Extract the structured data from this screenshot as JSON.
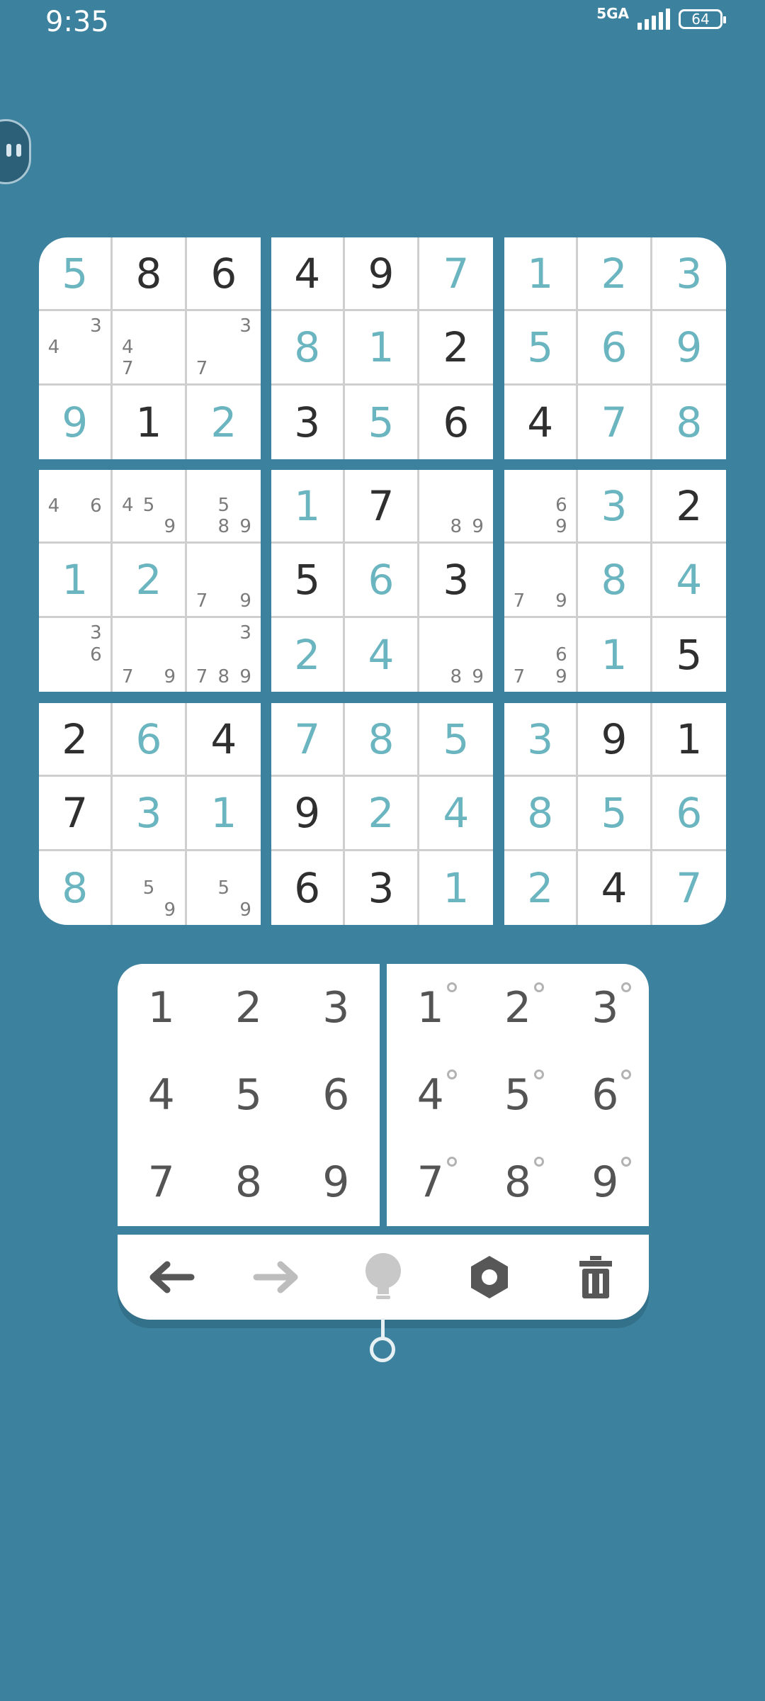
{
  "status_bar": {
    "time": "9:35",
    "network": "5GA",
    "battery": "64"
  },
  "colors": {
    "background": "#3c819d",
    "user_digit": "#6ab5bf",
    "given_digit": "#2f2f2f",
    "note": "#7b7b7b"
  },
  "board": {
    "cells": [
      [
        {
          "v": "5",
          "t": "user"
        },
        {
          "v": "8",
          "t": "given"
        },
        {
          "v": "6",
          "t": "given"
        },
        {
          "v": "4",
          "t": "given"
        },
        {
          "v": "9",
          "t": "given"
        },
        {
          "v": "7",
          "t": "user"
        },
        {
          "v": "1",
          "t": "user"
        },
        {
          "v": "2",
          "t": "user"
        },
        {
          "v": "3",
          "t": "user"
        }
      ],
      [
        {
          "n": [
            "3",
            "4"
          ]
        },
        {
          "n": [
            "4",
            "7"
          ]
        },
        {
          "n": [
            "3",
            "7"
          ]
        },
        {
          "v": "8",
          "t": "user"
        },
        {
          "v": "1",
          "t": "user"
        },
        {
          "v": "2",
          "t": "given"
        },
        {
          "v": "5",
          "t": "user"
        },
        {
          "v": "6",
          "t": "user"
        },
        {
          "v": "9",
          "t": "user"
        }
      ],
      [
        {
          "v": "9",
          "t": "user"
        },
        {
          "v": "1",
          "t": "given"
        },
        {
          "v": "2",
          "t": "user"
        },
        {
          "v": "3",
          "t": "given"
        },
        {
          "v": "5",
          "t": "user"
        },
        {
          "v": "6",
          "t": "given"
        },
        {
          "v": "4",
          "t": "given"
        },
        {
          "v": "7",
          "t": "user"
        },
        {
          "v": "8",
          "t": "user"
        }
      ],
      [
        {
          "n": [
            "4",
            "6"
          ]
        },
        {
          "n": [
            "4",
            "5",
            "9"
          ]
        },
        {
          "n": [
            "5",
            "8",
            "9"
          ]
        },
        {
          "v": "1",
          "t": "user"
        },
        {
          "v": "7",
          "t": "given"
        },
        {
          "n": [
            "8",
            "9"
          ]
        },
        {
          "n": [
            "6",
            "9"
          ]
        },
        {
          "v": "3",
          "t": "user"
        },
        {
          "v": "2",
          "t": "given"
        }
      ],
      [
        {
          "v": "1",
          "t": "user"
        },
        {
          "v": "2",
          "t": "user"
        },
        {
          "n": [
            "7",
            "9"
          ]
        },
        {
          "v": "5",
          "t": "given"
        },
        {
          "v": "6",
          "t": "user"
        },
        {
          "v": "3",
          "t": "given"
        },
        {
          "n": [
            "7",
            "9"
          ]
        },
        {
          "v": "8",
          "t": "user"
        },
        {
          "v": "4",
          "t": "user"
        }
      ],
      [
        {
          "n": [
            "3",
            "6"
          ]
        },
        {
          "n": [
            "7",
            "9"
          ]
        },
        {
          "n": [
            "3",
            "7",
            "8",
            "9"
          ]
        },
        {
          "v": "2",
          "t": "user"
        },
        {
          "v": "4",
          "t": "user"
        },
        {
          "n": [
            "8",
            "9"
          ]
        },
        {
          "n": [
            "6",
            "7",
            "9"
          ]
        },
        {
          "v": "1",
          "t": "user"
        },
        {
          "v": "5",
          "t": "given"
        }
      ],
      [
        {
          "v": "2",
          "t": "given"
        },
        {
          "v": "6",
          "t": "user"
        },
        {
          "v": "4",
          "t": "given"
        },
        {
          "v": "7",
          "t": "user"
        },
        {
          "v": "8",
          "t": "user"
        },
        {
          "v": "5",
          "t": "user"
        },
        {
          "v": "3",
          "t": "user"
        },
        {
          "v": "9",
          "t": "given"
        },
        {
          "v": "1",
          "t": "given"
        }
      ],
      [
        {
          "v": "7",
          "t": "given"
        },
        {
          "v": "3",
          "t": "user"
        },
        {
          "v": "1",
          "t": "user"
        },
        {
          "v": "9",
          "t": "given"
        },
        {
          "v": "2",
          "t": "user"
        },
        {
          "v": "4",
          "t": "user"
        },
        {
          "v": "8",
          "t": "user"
        },
        {
          "v": "5",
          "t": "user"
        },
        {
          "v": "6",
          "t": "user"
        }
      ],
      [
        {
          "v": "8",
          "t": "user"
        },
        {
          "n": [
            "5",
            "9"
          ]
        },
        {
          "n": [
            "5",
            "9"
          ]
        },
        {
          "v": "6",
          "t": "given"
        },
        {
          "v": "3",
          "t": "given"
        },
        {
          "v": "1",
          "t": "user"
        },
        {
          "v": "2",
          "t": "user"
        },
        {
          "v": "4",
          "t": "given"
        },
        {
          "v": "7",
          "t": "user"
        }
      ]
    ]
  },
  "number_pad": {
    "digits": [
      "1",
      "2",
      "3",
      "4",
      "5",
      "6",
      "7",
      "8",
      "9"
    ]
  },
  "notes_pad": {
    "digits": [
      "1",
      "2",
      "3",
      "4",
      "5",
      "6",
      "7",
      "8",
      "9"
    ]
  },
  "toolbar": {
    "tools": [
      {
        "icon": "undo-arrow-icon",
        "enabled": true
      },
      {
        "icon": "redo-arrow-icon",
        "enabled": false
      },
      {
        "icon": "hint-bulb-icon",
        "enabled": false
      },
      {
        "icon": "settings-gear-icon",
        "enabled": true
      },
      {
        "icon": "trash-icon",
        "enabled": true
      }
    ]
  }
}
